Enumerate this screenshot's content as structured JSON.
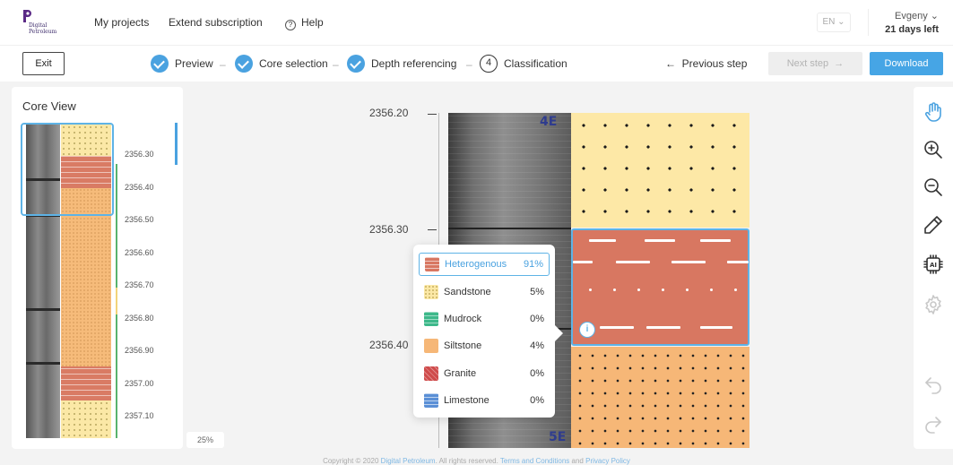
{
  "app": {
    "logo_text_line1": "Digital",
    "logo_text_line2": "Petroleum",
    "brand_color": "#5b2a86",
    "accent_color": "#46a5e5"
  },
  "nav": {
    "my_projects": "My projects",
    "extend_subscription": "Extend subscription",
    "help": "Help",
    "language": "EN",
    "user_name": "Evgeny",
    "days_left": "21 days left"
  },
  "steps": {
    "exit": "Exit",
    "items": [
      {
        "label": "Preview",
        "state": "done"
      },
      {
        "label": "Core selection",
        "state": "done"
      },
      {
        "label": "Depth referencing",
        "state": "done"
      },
      {
        "label": "Classification",
        "state": "current",
        "number": "4"
      }
    ],
    "previous": "Previous step",
    "next": "Next step",
    "download": "Download"
  },
  "core_view": {
    "title": "Core View",
    "depths": [
      "2356.30",
      "2356.40",
      "2356.50",
      "2356.60",
      "2356.70",
      "2356.80",
      "2356.90",
      "2357.00",
      "2357.10"
    ],
    "zoom": "25%"
  },
  "viewer": {
    "depths": [
      "2356.20",
      "2356.30",
      "2356.40"
    ],
    "core_marks": [
      "4E",
      "5E"
    ]
  },
  "classification_popup": {
    "items": [
      {
        "name": "Heterogenous",
        "pct": "91%",
        "selected": true
      },
      {
        "name": "Sandstone",
        "pct": "5%"
      },
      {
        "name": "Mudrock",
        "pct": "0%"
      },
      {
        "name": "Siltstone",
        "pct": "4%"
      },
      {
        "name": "Granite",
        "pct": "0%"
      },
      {
        "name": "Limestone",
        "pct": "0%"
      }
    ]
  },
  "toolbar": {
    "tools": [
      "hand-icon",
      "zoom-in-icon",
      "zoom-out-icon",
      "pencil-icon",
      "ai-chip-icon",
      "settings-icon",
      "undo-icon",
      "redo-icon"
    ]
  },
  "footer": {
    "copyright": "Copyright © 2020",
    "company": "Digital Petroleum",
    "rights": ". All rights reserved.",
    "terms": "Terms and Conditions",
    "and": "and",
    "privacy": "Privacy Policy"
  }
}
